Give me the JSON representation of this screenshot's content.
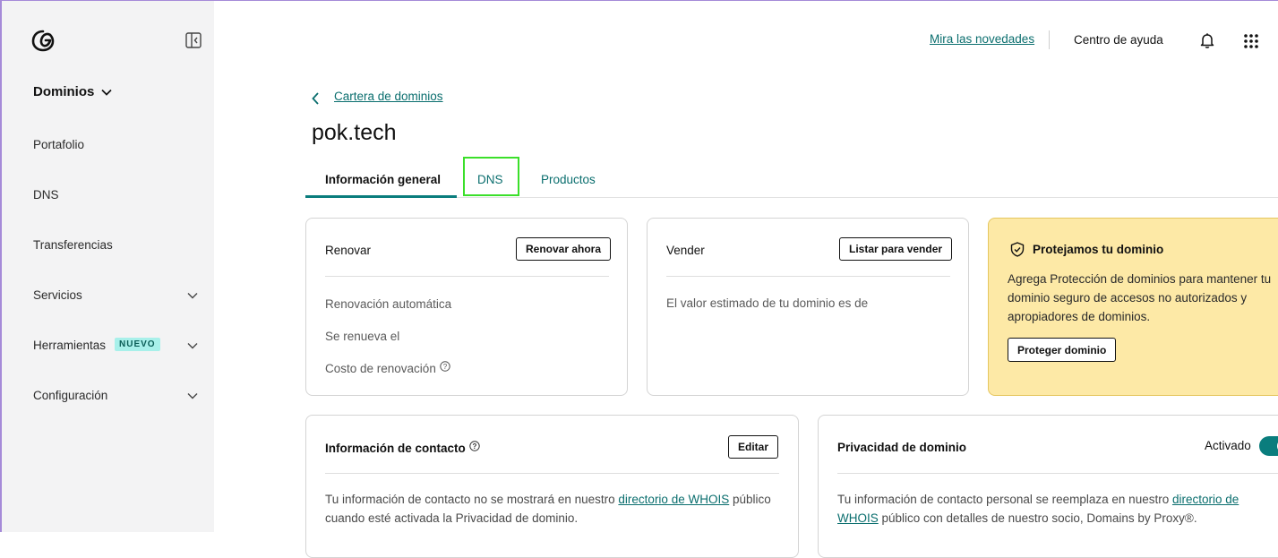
{
  "sidebar": {
    "section_title": "Dominios",
    "items": [
      {
        "label": "Portafolio"
      },
      {
        "label": "DNS"
      },
      {
        "label": "Transferencias"
      },
      {
        "label": "Servicios"
      },
      {
        "label": "Herramientas",
        "badge": "NUEVO"
      },
      {
        "label": "Configuración"
      }
    ]
  },
  "topbar": {
    "whats_new": "Mira las novedades",
    "help": "Centro de ayuda"
  },
  "breadcrumb": {
    "label": "Cartera de dominios"
  },
  "page": {
    "title": "pok.tech"
  },
  "tabs": [
    {
      "label": "Información general",
      "active": true
    },
    {
      "label": "DNS"
    },
    {
      "label": "Productos"
    }
  ],
  "renew_card": {
    "title": "Renovar",
    "button": "Renovar ahora",
    "rows": [
      "Renovación automática",
      "Se renueva el",
      "Costo de renovación"
    ]
  },
  "sell_card": {
    "title": "Vender",
    "button": "Listar para vender",
    "text": "El valor estimado de tu dominio es de"
  },
  "protect_card": {
    "title": "Protejamos tu dominio",
    "text": "Agrega Protección de dominios para mantener tu dominio seguro de accesos no autorizados y apropiadores de dominios.",
    "button": "Proteger dominio"
  },
  "contact_card": {
    "title": "Información de contacto",
    "button": "Editar",
    "text_before": "Tu información de contacto no se mostrará en nuestro ",
    "link": "directorio de WHOIS",
    "text_after": " público cuando esté activada la Privacidad de dominio."
  },
  "privacy_card": {
    "title": "Privacidad de dominio",
    "status": "Activado",
    "text_before": "Tu información de contacto personal se reemplaza en nuestro ",
    "link": "directorio de WHOIS",
    "text_after": " público con detalles de nuestro socio, Domains by Proxy®."
  },
  "colors": {
    "accent": "#0a7d7d",
    "sidebar_bg": "#f3f3f4",
    "promo_bg": "#fde9a6",
    "highlight": "#3bdf2a"
  }
}
